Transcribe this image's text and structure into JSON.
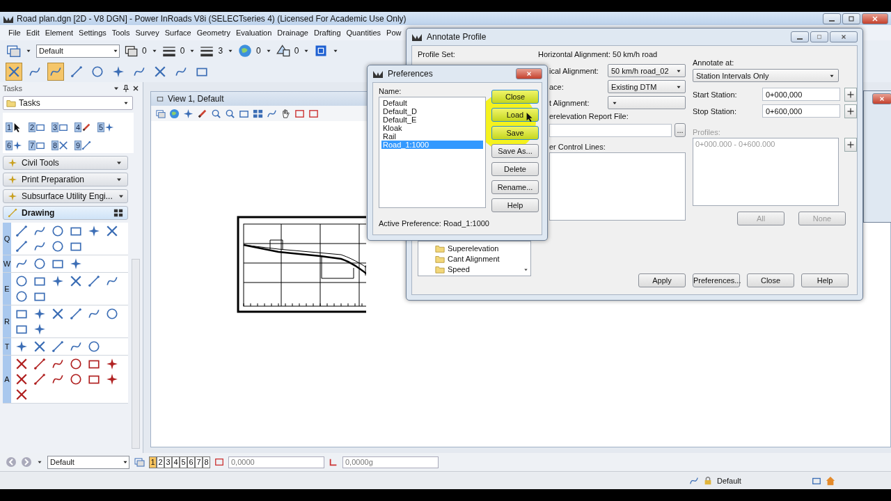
{
  "window": {
    "title": "Road plan.dgn [2D - V8 DGN] - Power InRoads V8i (SELECTseries 4) (Licensed For Academic Use Only)"
  },
  "menu": [
    "File",
    "Edit",
    "Element",
    "Settings",
    "Tools",
    "Survey",
    "Surface",
    "Geometry",
    "Evaluation",
    "Drainage",
    "Drafting",
    "Quantities",
    "Pow"
  ],
  "attributes": {
    "level_name": "Default",
    "values": [
      "0",
      "0",
      "3",
      "0",
      "0"
    ]
  },
  "snap_tools": [
    {
      "selected": true
    },
    {
      "selected": false
    },
    {
      "selected": true
    },
    {
      "selected": false
    },
    {
      "selected": false
    },
    {
      "selected": false
    },
    {
      "selected": false
    },
    {
      "selected": false
    },
    {
      "selected": false
    },
    {
      "selected": false
    }
  ],
  "tasks": {
    "title": "Tasks",
    "dropdown": "Tasks",
    "task_tools": [
      "1",
      "2",
      "3",
      "4",
      "5",
      "6",
      "7",
      "8",
      "9"
    ],
    "sections": [
      {
        "label": "Civil Tools",
        "expanded": false
      },
      {
        "label": "Print Preparation",
        "expanded": false
      },
      {
        "label": "Subsurface Utility Engi...",
        "expanded": false
      },
      {
        "label": "Drawing",
        "expanded": true
      }
    ],
    "tool_rows": [
      {
        "key": "Q"
      },
      {
        "key": "W"
      },
      {
        "key": "E"
      },
      {
        "key": "R"
      },
      {
        "key": "T"
      },
      {
        "key": "A"
      }
    ]
  },
  "view": {
    "title": "View 1, Default"
  },
  "annotate_profile": {
    "title": "Annotate Profile",
    "profile_set_label": "Profile Set:",
    "horizontal_alignment_label": "Horizontal Alignment:",
    "horizontal_alignment": "50 km/h road",
    "fields": [
      {
        "label": "ical Alignment:",
        "value": "50 km/h road_02"
      },
      {
        "label": "ace:",
        "value": "Existing DTM"
      },
      {
        "label": "t Alignment:"
      }
    ],
    "report_file_label": "erelevation Report File:",
    "browse": "...",
    "control_lines_label": "er Control Lines:",
    "tree": [
      "Superelevation",
      "Cant Alignment",
      "Speed"
    ],
    "annotate_at_label": "Annotate at:",
    "annotate_at": "Station Intervals Only",
    "start_station_label": "Start Station:",
    "start_station": "0+000,000",
    "stop_station_label": "Stop Station:",
    "stop_station": "0+600,000",
    "profiles_label": "Profiles:",
    "profiles_disabled": true,
    "profiles": [
      "0+000.000 - 0+600.000"
    ],
    "selection_buttons": [
      {
        "label": "All",
        "disabled": true
      },
      {
        "label": "None",
        "disabled": true
      }
    ],
    "buttons": [
      "Apply",
      "Preferences...",
      "Close",
      "Help"
    ]
  },
  "preferences": {
    "title": "Preferences",
    "name_label": "Name:",
    "items": [
      {
        "label": "Default",
        "selected": false
      },
      {
        "label": "Default_D",
        "selected": false
      },
      {
        "label": "Default_E",
        "selected": false
      },
      {
        "label": "Kloak",
        "selected": false
      },
      {
        "label": "Rail",
        "selected": false
      },
      {
        "label": "Road_1:1000",
        "selected": true
      }
    ],
    "buttons": [
      {
        "label": "Close",
        "highlighted": true
      },
      {
        "label": "Load",
        "highlighted": true
      },
      {
        "label": "Save",
        "highlighted": true
      },
      {
        "label": "Save As...",
        "highlighted": false
      },
      {
        "label": "Delete",
        "highlighted": false
      },
      {
        "label": "Rename...",
        "highlighted": false
      },
      {
        "label": "Help",
        "highlighted": false
      }
    ],
    "active_preference": "Active Preference: Road_1:1000"
  },
  "bottom_toolbar": {
    "view_group": "Default",
    "views": [
      {
        "label": "1",
        "selected": true
      },
      {
        "label": "2",
        "selected": false
      },
      {
        "label": "3",
        "selected": false
      },
      {
        "label": "4",
        "selected": false
      },
      {
        "label": "5",
        "selected": false
      },
      {
        "label": "6",
        "selected": false
      },
      {
        "label": "7",
        "selected": false
      },
      {
        "label": "8",
        "selected": false
      }
    ],
    "fields": [
      "0,0000",
      "0,0000g"
    ]
  },
  "status_bar": {
    "level_name": "Default"
  }
}
